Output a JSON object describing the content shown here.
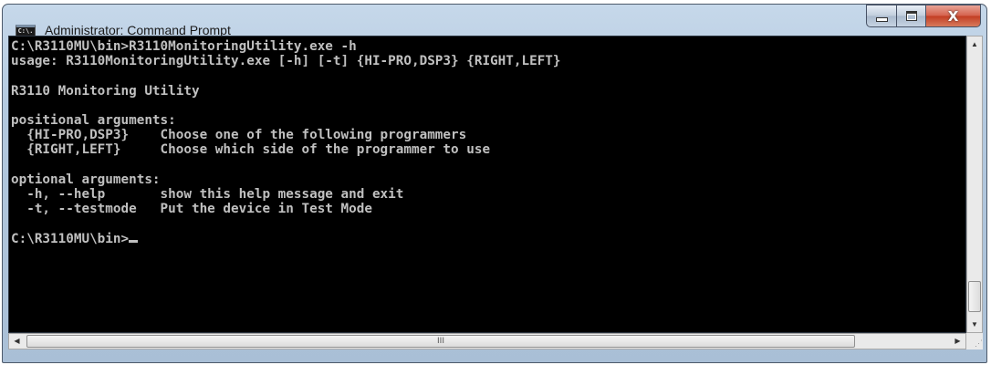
{
  "window": {
    "title": "Administrator: Command Prompt",
    "app_icon_text": "C:\\."
  },
  "caption_buttons": {
    "minimize_icon": "minimize-icon",
    "maximize_icon": "maximize-icon",
    "close_glyph": "X"
  },
  "console": {
    "lines": [
      "C:\\R3110MU\\bin>R3110MonitoringUtility.exe -h",
      "usage: R3110MonitoringUtility.exe [-h] [-t] {HI-PRO,DSP3} {RIGHT,LEFT}",
      "",
      "R3110 Monitoring Utility",
      "",
      "positional arguments:",
      "  {HI-PRO,DSP3}    Choose one of the following programmers",
      "  {RIGHT,LEFT}     Choose which side of the programmer to use",
      "",
      "optional arguments:",
      "  -h, --help       show this help message and exit",
      "  -t, --testmode   Put the device in Test Mode",
      ""
    ],
    "prompt": "C:\\R3110MU\\bin>"
  },
  "scrollbars": {
    "up_arrow": "▲",
    "down_arrow": "▼",
    "left_arrow": "◀",
    "right_arrow": "▶",
    "hthumb_grip": "III",
    "resize_grip": "⋰"
  },
  "colors": {
    "console_bg": "#000000",
    "console_fg": "#c0c0c0",
    "close_button": "#c23d22"
  }
}
